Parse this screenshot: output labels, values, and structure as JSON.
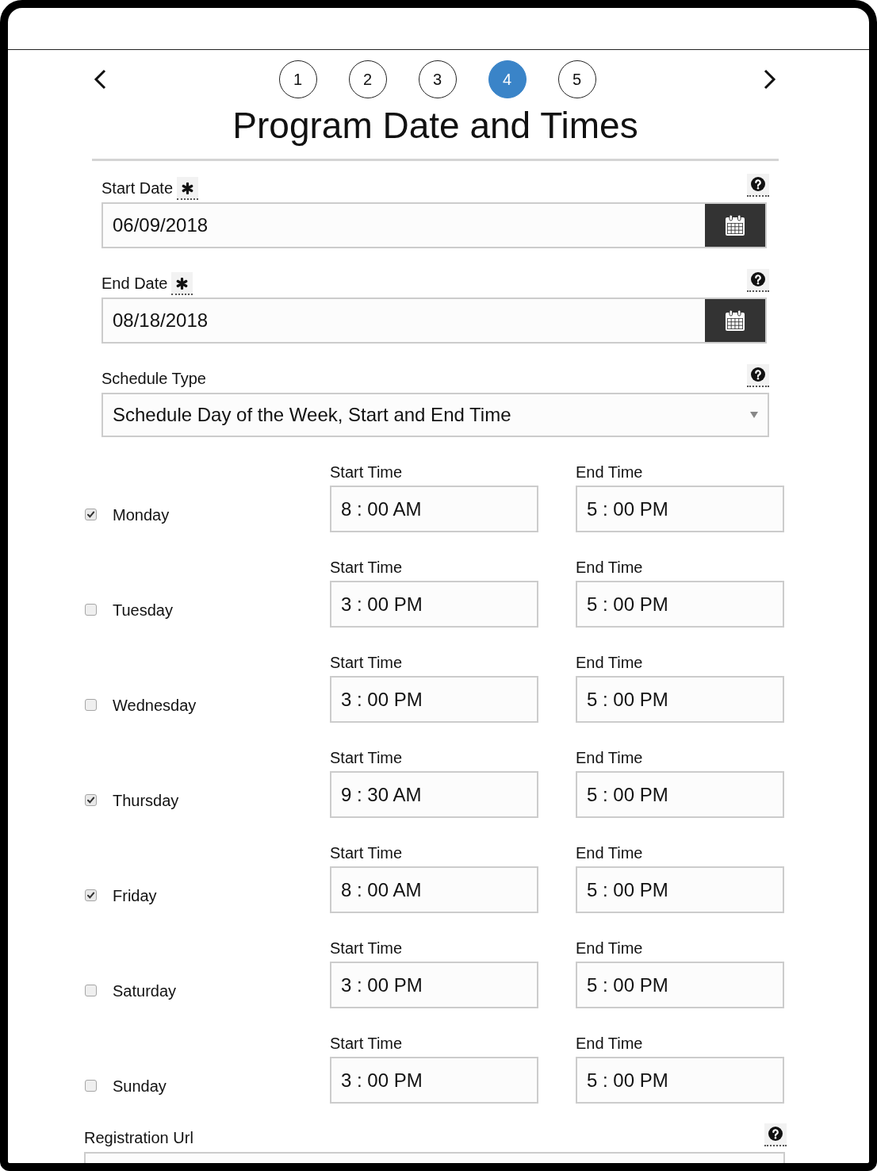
{
  "steps": [
    {
      "label": "1",
      "selected": false
    },
    {
      "label": "2",
      "selected": false
    },
    {
      "label": "3",
      "selected": false
    },
    {
      "label": "4",
      "selected": true
    },
    {
      "label": "5",
      "selected": false
    }
  ],
  "title": "Program Date and Times",
  "fields": [
    {
      "kind": "date",
      "label": "Start Date",
      "required": true,
      "value": "06/09/2018"
    },
    {
      "kind": "date",
      "label": "End Date",
      "required": true,
      "value": "08/18/2018"
    },
    {
      "kind": "select",
      "label": "Schedule Type",
      "required": false,
      "value": "Schedule Day of the Week, Start and End Time"
    }
  ],
  "days": [
    {
      "day": "Monday",
      "checked": true,
      "start_label": "Start Time",
      "start_time": "8 : 00 AM",
      "end_label": "End Time",
      "end_time": "5 : 00 PM"
    },
    {
      "day": "Tuesday",
      "checked": false,
      "start_label": "Start Time",
      "start_time": "3 : 00 PM",
      "end_label": "End Time",
      "end_time": "5 : 00 PM"
    },
    {
      "day": "Wednesday",
      "checked": false,
      "start_label": "Start Time",
      "start_time": "3 : 00 PM",
      "end_label": "End Time",
      "end_time": "5 : 00 PM"
    },
    {
      "day": "Thursday",
      "checked": true,
      "start_label": "Start Time",
      "start_time": "9 : 30 AM",
      "end_label": "End Time",
      "end_time": "5 : 00 PM"
    },
    {
      "day": "Friday",
      "checked": true,
      "start_label": "Start Time",
      "start_time": "8 : 00 AM",
      "end_label": "End Time",
      "end_time": "5 : 00 PM"
    },
    {
      "day": "Saturday",
      "checked": false,
      "start_label": "Start Time",
      "start_time": "3 : 00 PM",
      "end_label": "End Time",
      "end_time": "5 : 00 PM"
    },
    {
      "day": "Sunday",
      "checked": false,
      "start_label": "Start Time",
      "start_time": "3 : 00 PM",
      "end_label": "End Time",
      "end_time": "5 : 00 PM"
    }
  ],
  "registration": {
    "label": "Registration Url"
  }
}
